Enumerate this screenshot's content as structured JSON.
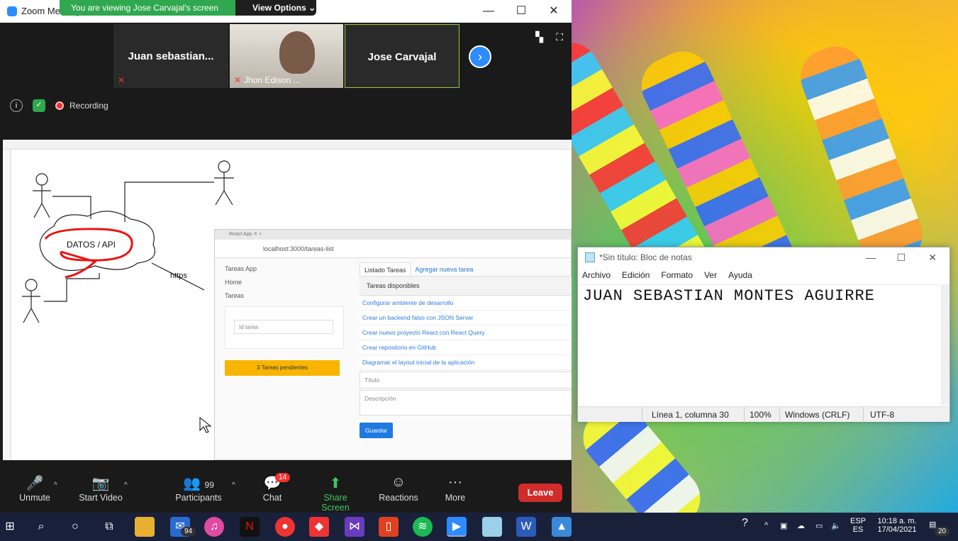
{
  "zoom": {
    "window_title": "Zoom Meeting",
    "banner_message": "You are viewing Jose Carvajal's screen",
    "view_options": "View Options ⌄",
    "participants": [
      {
        "name": "Juan  sebastian...",
        "sub": ""
      },
      {
        "name": "",
        "sub": "Jhon Edison ..."
      },
      {
        "name": "Jose Carvajal",
        "sub": ""
      }
    ],
    "recording_label": "Recording",
    "controls": {
      "unmute": "Unmute",
      "start_video": "Start Video",
      "participants": "Participants",
      "participants_count": "99",
      "chat": "Chat",
      "chat_badge": "14",
      "share_screen": "Share Screen",
      "reactions": "Reactions",
      "more": "More",
      "leave": "Leave"
    }
  },
  "shared_screen": {
    "diagram": {
      "cloud_label": "DATOS / API",
      "arrow_label": "https"
    },
    "browser": {
      "address": "localhost:3000/tareas-list",
      "sidebar": [
        "Tareas App",
        "Home",
        "Tareas"
      ],
      "search_placeholder": "Id tarea",
      "pending_button": "3  Tareas pendientes",
      "tabs": [
        "Listado Tareas",
        "Agregar nueva tarea"
      ],
      "heading": "Tareas disponibles",
      "tasks": [
        "Configurar ambiente de desarrollo",
        "Crear un backend falso con JSON Server",
        "Crear nuevo proyecto React con React Query",
        "Crear repositorio en GitHub",
        "Diagramar el layout inicial de la aplicación"
      ],
      "title_field": "Título",
      "description_field": "Descripción",
      "save_button": "Guardar"
    }
  },
  "notepad": {
    "title": "*Sin título: Bloc de notas",
    "menu": [
      "Archivo",
      "Edición",
      "Formato",
      "Ver",
      "Ayuda"
    ],
    "content": "JUAN SEBASTIAN MONTES AGUIRRE",
    "status": {
      "position": "Línea 1, columna 30",
      "zoom": "100%",
      "line_endings": "Windows (CRLF)",
      "encoding": "UTF-8"
    }
  },
  "taskbar": {
    "mail_badge": "94",
    "lang_top": "ESP",
    "lang_bottom": "ES",
    "time": "10:18 a. m.",
    "date": "17/04/2021",
    "notification_count": "20"
  }
}
